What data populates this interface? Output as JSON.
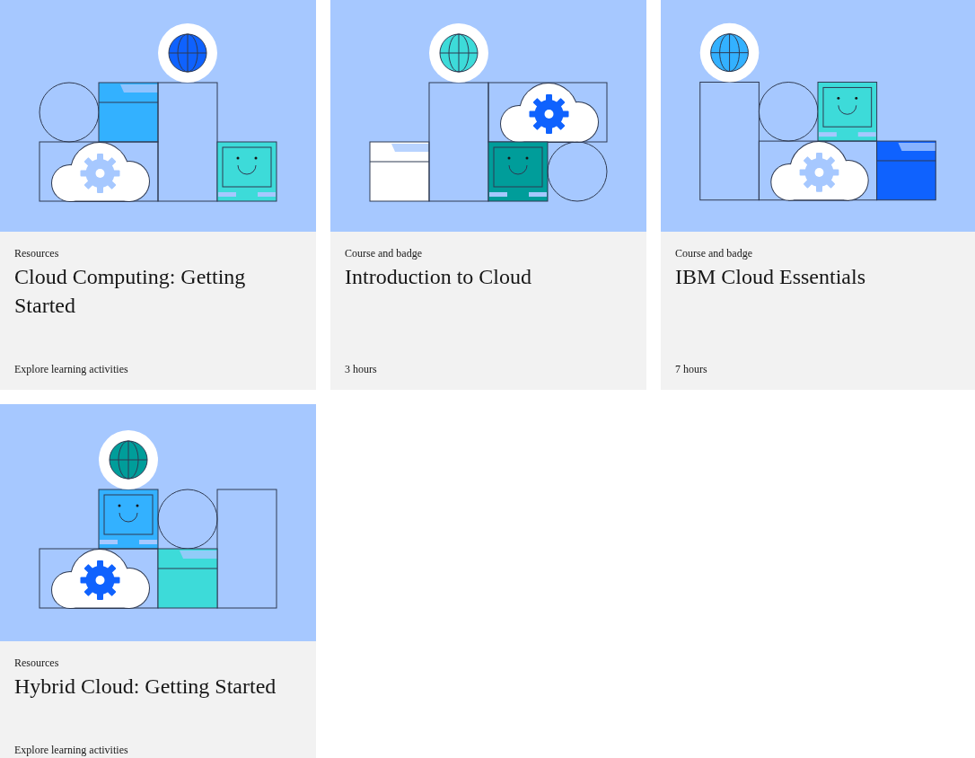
{
  "cards": [
    {
      "category": "Resources",
      "title": "Cloud Computing: Getting Started",
      "footer": "Explore learning activities"
    },
    {
      "category": "Course and badge",
      "title": "Introduction to Cloud",
      "footer": "3 hours"
    },
    {
      "category": "Course and badge",
      "title": "IBM Cloud Essentials",
      "footer": "7 hours"
    },
    {
      "category": "Resources",
      "title": "Hybrid Cloud: Getting Started",
      "footer": "Explore learning activities"
    }
  ]
}
